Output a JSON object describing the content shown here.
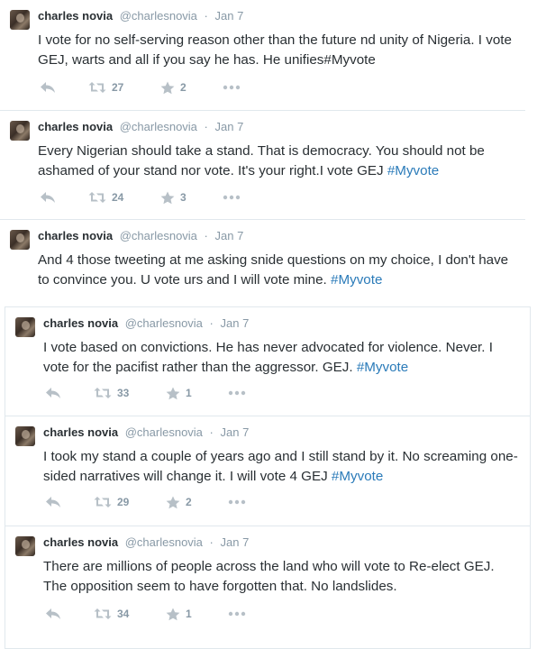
{
  "colors": {
    "name": "#292f33",
    "meta": "#8899a6",
    "hashtag": "#2b7bb9",
    "icon": "#b7c0c7",
    "border": "#e1e8ed"
  },
  "icons": [
    "avatar",
    "reply-icon",
    "retweet-icon",
    "favorite-icon",
    "more-icon"
  ],
  "tweets": [
    {
      "name": "charles novia",
      "handle": "@charlesnovia",
      "separator": "·",
      "date": "Jan 7",
      "text": "I vote for no self-serving reason other than the future nd unity of Nigeria. I vote GEJ, warts and all if you say he has. He unifies#Myvote",
      "hashtag": "",
      "retweets": "27",
      "favorites": "2"
    },
    {
      "name": "charles novia",
      "handle": "@charlesnovia",
      "separator": "·",
      "date": "Jan 7",
      "text": "Every Nigerian should take a stand. That is democracy. You should not be ashamed of your stand nor vote. It's your right.I vote GEJ ",
      "hashtag": "#Myvote",
      "retweets": "24",
      "favorites": "3"
    },
    {
      "name": "charles novia",
      "handle": "@charlesnovia",
      "separator": "·",
      "date": "Jan 7",
      "text": "And 4 those tweeting at me asking snide questions on my choice, I don't have to convince you. U vote urs and I will vote mine. ",
      "hashtag": "#Myvote",
      "retweets": "",
      "favorites": ""
    },
    {
      "name": "charles novia",
      "handle": "@charlesnovia",
      "separator": "·",
      "date": "Jan 7",
      "text": "I vote based on convictions. He has never advocated for violence. Never. I vote for the pacifist rather than the aggressor. GEJ. ",
      "hashtag": "#Myvote",
      "retweets": "33",
      "favorites": "1"
    },
    {
      "name": "charles novia",
      "handle": "@charlesnovia",
      "separator": "·",
      "date": "Jan 7",
      "text": "I took my stand a couple of years ago and I still stand by it. No screaming one-sided narratives will change it. I will vote 4 GEJ ",
      "hashtag": "#Myvote",
      "retweets": "29",
      "favorites": "2"
    },
    {
      "name": "charles novia",
      "handle": "@charlesnovia",
      "separator": "·",
      "date": "Jan 7",
      "text": "There are millions of people across the land who will vote to Re-elect GEJ. The opposition seem to have forgotten that. No landslides.",
      "hashtag": "",
      "retweets": "34",
      "favorites": "1"
    }
  ]
}
